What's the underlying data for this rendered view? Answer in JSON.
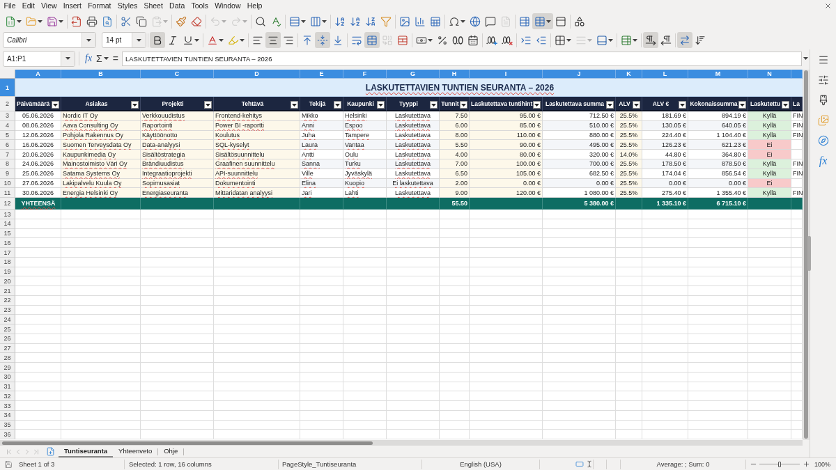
{
  "menu": [
    "File",
    "Edit",
    "View",
    "Insert",
    "Format",
    "Styles",
    "Sheet",
    "Data",
    "Tools",
    "Window",
    "Help"
  ],
  "toolbar_standard": [
    [
      {
        "kind": "new",
        "dropdown": true,
        "pressed": false,
        "disabled": false
      },
      {
        "kind": "open",
        "dropdown": true,
        "pressed": false,
        "disabled": false
      },
      {
        "kind": "save",
        "dropdown": true,
        "pressed": false,
        "disabled": false
      }
    ],
    [
      {
        "kind": "pdf",
        "dropdown": false,
        "pressed": false,
        "disabled": false
      },
      {
        "kind": "print",
        "dropdown": false,
        "pressed": false,
        "disabled": false
      },
      {
        "kind": "preview",
        "dropdown": false,
        "pressed": false,
        "disabled": false
      }
    ],
    [
      {
        "kind": "cut",
        "dropdown": false,
        "pressed": false,
        "disabled": false
      },
      {
        "kind": "copy",
        "dropdown": false,
        "pressed": false,
        "disabled": false
      },
      {
        "kind": "paste",
        "dropdown": true,
        "pressed": false,
        "disabled": true
      }
    ],
    [
      {
        "kind": "clone",
        "dropdown": false,
        "pressed": false,
        "disabled": false
      },
      {
        "kind": "clear",
        "dropdown": false,
        "pressed": false,
        "disabled": false
      }
    ],
    [
      {
        "kind": "undo",
        "dropdown": true,
        "pressed": false,
        "disabled": true
      },
      {
        "kind": "redo",
        "dropdown": true,
        "pressed": false,
        "disabled": true
      }
    ],
    [
      {
        "kind": "find",
        "dropdown": false,
        "pressed": false,
        "disabled": false
      },
      {
        "kind": "spell",
        "dropdown": false,
        "pressed": false,
        "disabled": false
      }
    ],
    [
      {
        "kind": "row",
        "dropdown": true,
        "pressed": false,
        "disabled": false
      },
      {
        "kind": "column",
        "dropdown": true,
        "pressed": false,
        "disabled": false
      }
    ],
    [
      {
        "kind": "sortaz",
        "dropdown": false,
        "pressed": false,
        "disabled": false
      },
      {
        "kind": "sortasc",
        "dropdown": false,
        "pressed": false,
        "disabled": false
      },
      {
        "kind": "sortdesc",
        "dropdown": false,
        "pressed": false,
        "disabled": false
      },
      {
        "kind": "filter",
        "dropdown": false,
        "pressed": false,
        "disabled": false
      }
    ],
    [
      {
        "kind": "image",
        "dropdown": false,
        "pressed": false,
        "disabled": false
      },
      {
        "kind": "chart",
        "dropdown": false,
        "pressed": false,
        "disabled": false
      },
      {
        "kind": "pivot",
        "dropdown": false,
        "pressed": false,
        "disabled": false
      }
    ],
    [
      {
        "kind": "special",
        "dropdown": true,
        "pressed": false,
        "disabled": false
      },
      {
        "kind": "hyperlink",
        "dropdown": false,
        "pressed": false,
        "disabled": false
      },
      {
        "kind": "comment",
        "dropdown": false,
        "pressed": false,
        "disabled": false
      },
      {
        "kind": "headerfooter",
        "dropdown": false,
        "pressed": false,
        "disabled": true
      }
    ],
    [
      {
        "kind": "printarea",
        "dropdown": false,
        "pressed": false,
        "disabled": false
      },
      {
        "kind": "freeze",
        "dropdown": true,
        "pressed": true,
        "disabled": false
      },
      {
        "kind": "split",
        "dropdown": false,
        "pressed": false,
        "disabled": false
      }
    ],
    [
      {
        "kind": "draw",
        "dropdown": false,
        "pressed": false,
        "disabled": false
      }
    ]
  ],
  "toolbar_formatting": {
    "font_name": "Calibri",
    "font_size": "14 pt",
    "groups": [
      [
        {
          "kind": "bold",
          "dropdown": false,
          "pressed": true,
          "disabled": false
        },
        {
          "kind": "italic",
          "dropdown": false,
          "pressed": false,
          "disabled": false
        },
        {
          "kind": "underline",
          "dropdown": true,
          "pressed": false,
          "disabled": false
        }
      ],
      [
        {
          "kind": "fontcolor",
          "dropdown": true,
          "pressed": false,
          "disabled": false
        },
        {
          "kind": "highlight",
          "dropdown": true,
          "pressed": false,
          "disabled": false
        }
      ],
      [
        {
          "kind": "alignleft",
          "dropdown": false,
          "pressed": false,
          "disabled": false
        },
        {
          "kind": "aligncenter",
          "dropdown": false,
          "pressed": true,
          "disabled": false
        },
        {
          "kind": "alignright",
          "dropdown": false,
          "pressed": false,
          "disabled": false
        }
      ],
      [
        {
          "kind": "aligntop",
          "dropdown": false,
          "pressed": false,
          "disabled": false
        },
        {
          "kind": "alignmiddle",
          "dropdown": false,
          "pressed": true,
          "disabled": false
        },
        {
          "kind": "alignbottom",
          "dropdown": false,
          "pressed": false,
          "disabled": false
        }
      ],
      [
        {
          "kind": "wrap",
          "dropdown": false,
          "pressed": false,
          "disabled": false
        },
        {
          "kind": "mergecenter",
          "dropdown": false,
          "pressed": true,
          "disabled": false
        },
        {
          "kind": "merge",
          "dropdown": false,
          "pressed": false,
          "disabled": true
        },
        {
          "kind": "unmerge",
          "dropdown": false,
          "pressed": false,
          "disabled": false
        }
      ],
      [
        {
          "kind": "currency",
          "dropdown": true,
          "pressed": false,
          "disabled": false
        },
        {
          "kind": "percent",
          "dropdown": false,
          "pressed": false,
          "disabled": false
        },
        {
          "kind": "standard",
          "dropdown": false,
          "pressed": false,
          "disabled": false
        },
        {
          "kind": "date",
          "dropdown": false,
          "pressed": false,
          "disabled": false
        }
      ],
      [
        {
          "kind": "adddecimal",
          "dropdown": false,
          "pressed": false,
          "disabled": false
        },
        {
          "kind": "deldecimal",
          "dropdown": false,
          "pressed": false,
          "disabled": false
        }
      ],
      [
        {
          "kind": "indentinc",
          "dropdown": false,
          "pressed": false,
          "disabled": false
        },
        {
          "kind": "indentdec",
          "dropdown": false,
          "pressed": false,
          "disabled": false
        }
      ],
      [
        {
          "kind": "borders",
          "dropdown": true,
          "pressed": false,
          "disabled": false
        },
        {
          "kind": "borderstyle",
          "dropdown": true,
          "pressed": false,
          "disabled": true
        },
        {
          "kind": "bordercolor",
          "dropdown": true,
          "pressed": false,
          "disabled": false
        }
      ],
      [
        {
          "kind": "conditional",
          "dropdown": true,
          "pressed": false,
          "disabled": false
        }
      ],
      [
        {
          "kind": "ltr",
          "dropdown": false,
          "pressed": true,
          "disabled": false
        },
        {
          "kind": "rtl",
          "dropdown": false,
          "pressed": false,
          "disabled": false
        }
      ],
      [
        {
          "kind": "textdir",
          "dropdown": false,
          "pressed": true,
          "disabled": false
        },
        {
          "kind": "vertical",
          "dropdown": false,
          "pressed": false,
          "disabled": false
        }
      ]
    ]
  },
  "formula_bar": {
    "name_box": "A1:P1",
    "function_wizard": "fx",
    "sum": "Σ",
    "equals": "=",
    "content": "LASKUTETTAVIEN TUNTIEN SEURANTA – 2026"
  },
  "sidebar": {
    "functions": "fx"
  },
  "sheet": {
    "columns": [
      {
        "letter": "A",
        "selected": true,
        "header": "Päivämäärä",
        "spell_marked": false
      },
      {
        "letter": "B",
        "selected": true,
        "header": "Asiakas",
        "spell_marked": true
      },
      {
        "letter": "C",
        "selected": true,
        "header": "Projekti",
        "spell_marked": true
      },
      {
        "letter": "D",
        "selected": true,
        "header": "Tehtävä",
        "spell_marked": true
      },
      {
        "letter": "E",
        "selected": true,
        "header": "Tekijä",
        "spell_marked": true
      },
      {
        "letter": "F",
        "selected": true,
        "header": "Kaupunki",
        "spell_marked": true
      },
      {
        "letter": "G",
        "selected": true,
        "header": "Tyyppi",
        "spell_marked": true
      },
      {
        "letter": "H",
        "selected": true,
        "header": "Tunnit",
        "spell_marked": false
      },
      {
        "letter": "I",
        "selected": true,
        "header": "Laskutettava tuntihint",
        "spell_marked": false
      },
      {
        "letter": "J",
        "selected": true,
        "header": "Laskutettava summa",
        "spell_marked": false
      },
      {
        "letter": "K",
        "selected": true,
        "header": "ALV",
        "spell_marked": false
      },
      {
        "letter": "L",
        "selected": true,
        "header": "ALV €",
        "spell_marked": false
      },
      {
        "letter": "M",
        "selected": true,
        "header": "Kokonaissumma",
        "spell_marked": false
      },
      {
        "letter": "N",
        "selected": true,
        "header": "Laskutettu",
        "spell_marked": false
      }
    ],
    "column_15": {
      "selected": true,
      "header": "La"
    },
    "title_row": {
      "number": "1",
      "selected": true,
      "title": "LASKUTETTAVIEN TUNTIEN SEURANTA – 2026",
      "spell_marked": true
    },
    "header_row": {
      "number": "2",
      "selected": false
    },
    "rows": [
      {
        "number": "3",
        "selected": false,
        "billed": true,
        "cells": [
          "05.06.2026",
          "Nordic IT Oy",
          "Verkkouudistus",
          "Frontend-kehitys",
          "Mikko",
          "Helsinki",
          "Laskutettava",
          "7.50",
          "95.00 €",
          "712.50 €",
          "25.5%",
          "181.69 €",
          "894.19 €",
          "Kyllä"
        ],
        "column_15": "FIN"
      },
      {
        "number": "4",
        "selected": false,
        "billed": true,
        "cells": [
          "08.06.2026",
          "Aava Consulting Oy",
          "Raportointi",
          "Power BI -raportti",
          "Anni",
          "Espoo",
          "Laskutettava",
          "6.00",
          "85.00 €",
          "510.00 €",
          "25.5%",
          "130.05 €",
          "640.05 €",
          "Kyllä"
        ],
        "column_15": "FIN"
      },
      {
        "number": "5",
        "selected": false,
        "billed": true,
        "cells": [
          "12.06.2026",
          "Pohjola Rakennus Oy",
          "Käyttöönotto",
          "Koulutus",
          "Juha",
          "Tampere",
          "Laskutettava",
          "8.00",
          "110.00 €",
          "880.00 €",
          "25.5%",
          "224.40 €",
          "1 104.40 €",
          "Kyllä"
        ],
        "column_15": "FIN"
      },
      {
        "number": "6",
        "selected": false,
        "billed": false,
        "cells": [
          "16.06.2026",
          "Suomen Terveysdata Oy",
          "Data-analyysi",
          "SQL-kyselyt",
          "Laura",
          "Vantaa",
          "Laskutettava",
          "5.50",
          "90.00 €",
          "495.00 €",
          "25.5%",
          "126.23 €",
          "621.23 €",
          "Ei"
        ]
      },
      {
        "number": "7",
        "selected": false,
        "billed": false,
        "cells": [
          "20.06.2026",
          "Kaupunkimedia Oy",
          "Sisältöstrategia",
          "Sisältösuunnittelu",
          "Antti",
          "Oulu",
          "Laskutettava",
          "4.00",
          "80.00 €",
          "320.00 €",
          "14.0%",
          "44.80 €",
          "364.80 €",
          "Ei"
        ]
      },
      {
        "number": "8",
        "selected": false,
        "billed": true,
        "cells": [
          "24.06.2026",
          "Mainostoimisto Väri Oy",
          "Brändiuudistus",
          "Graafinen suunnittelu",
          "Sanna",
          "Turku",
          "Laskutettava",
          "7.00",
          "100.00 €",
          "700.00 €",
          "25.5%",
          "178.50 €",
          "878.50 €",
          "Kyllä"
        ],
        "column_15": "FIN"
      },
      {
        "number": "9",
        "selected": false,
        "billed": true,
        "cells": [
          "25.06.2026",
          "Satama Systems Oy",
          "Integraatioprojekti",
          "API-suunnittelu",
          "Ville",
          "Jyväskylä",
          "Laskutettava",
          "6.50",
          "105.00 €",
          "682.50 €",
          "25.5%",
          "174.04 €",
          "856.54 €",
          "Kyllä"
        ],
        "column_15": "FIN"
      },
      {
        "number": "10",
        "selected": false,
        "billed": false,
        "cells": [
          "27.06.2026",
          "Lakipalvelu Kuula Oy",
          "Sopimusasiat",
          "Dokumentointi",
          "Elina",
          "Kuopio",
          "Ei laskutettava",
          "2.00",
          "0.00 €",
          "0.00 €",
          "25.5%",
          "0.00 €",
          "0.00 €",
          "Ei"
        ]
      },
      {
        "number": "11",
        "selected": false,
        "billed": true,
        "cells": [
          "30.06.2026",
          "Energia Helsinki Oy",
          "Energiaseuranta",
          "Mittaridatan analyysi",
          "Jari",
          "Lahti",
          "Laskutettava",
          "9.00",
          "120.00 €",
          "1 080.00 €",
          "25.5%",
          "275.40 €",
          "1 355.40 €",
          "Kyllä"
        ],
        "column_15": "FIN"
      }
    ],
    "totals": {
      "number": "12",
      "selected": false,
      "label": "YHTEENSÄ",
      "spell_marked": true,
      "hours": "55.50",
      "billable_sum": "5 380.00 €",
      "vat_sum": "1 335.10 €",
      "grand_total": "6 715.10 €"
    },
    "empty_rows": [
      {
        "number": "13",
        "selected": false
      },
      {
        "number": "14",
        "selected": false
      },
      {
        "number": "15",
        "selected": false
      },
      {
        "number": "16",
        "selected": false
      },
      {
        "number": "17",
        "selected": false
      },
      {
        "number": "18",
        "selected": false
      },
      {
        "number": "19",
        "selected": false
      },
      {
        "number": "20",
        "selected": false
      },
      {
        "number": "21",
        "selected": false
      },
      {
        "number": "22",
        "selected": false
      },
      {
        "number": "23",
        "selected": false
      },
      {
        "number": "24",
        "selected": false
      },
      {
        "number": "25",
        "selected": false
      },
      {
        "number": "26",
        "selected": false
      },
      {
        "number": "27",
        "selected": false
      },
      {
        "number": "28",
        "selected": false
      },
      {
        "number": "29",
        "selected": false
      },
      {
        "number": "30",
        "selected": false
      },
      {
        "number": "31",
        "selected": false
      },
      {
        "number": "32",
        "selected": false
      },
      {
        "number": "33",
        "selected": false
      },
      {
        "number": "34",
        "selected": false
      },
      {
        "number": "35",
        "selected": false
      },
      {
        "number": "36",
        "selected": false
      }
    ]
  },
  "sheet_tabs": {
    "navigation_disabled": true,
    "tabs": [
      {
        "label": "Tuntiseuranta",
        "selected": true
      },
      {
        "label": "Yhteenveto",
        "selected": false
      },
      {
        "label": "Ohje",
        "selected": false
      }
    ]
  },
  "status_bar": {
    "sheet": "Sheet 1 of 3",
    "selection": "Selected: 1 row, 16 columns",
    "page_style": "PageStyle_Tuntiseuranta",
    "language": "English (USA)",
    "summary": "Average: ; Sum: 0",
    "zoom": {
      "level": 0.5,
      "reading": "100%"
    }
  }
}
